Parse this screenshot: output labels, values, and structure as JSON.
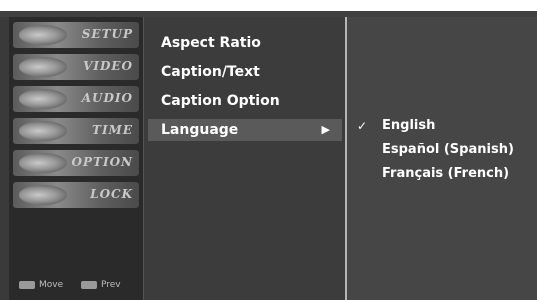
{
  "sidebar": {
    "tiles": [
      "SETUP",
      "VIDEO",
      "AUDIO",
      "TIME",
      "OPTION",
      "LOCK"
    ],
    "hints": [
      "Move",
      "Prev"
    ]
  },
  "menu": {
    "items": [
      "Aspect Ratio",
      "Caption/Text",
      "Caption Option",
      "Language"
    ],
    "selected_index": 3,
    "arrow": "▶"
  },
  "submenu": {
    "options": [
      "English",
      "Español (Spanish)",
      "Français (French)"
    ],
    "checked_index": 0,
    "check_mark": "✓"
  }
}
